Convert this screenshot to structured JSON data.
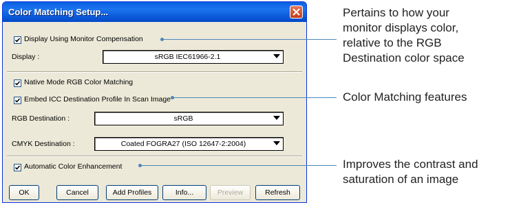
{
  "dialog": {
    "title": "Color Matching Setup...",
    "display_compensation": {
      "label": "Display Using Monitor Compensation",
      "checked": true
    },
    "display": {
      "label": "Display :",
      "value": "sRGB IEC61966-2.1"
    },
    "native_mode": {
      "label": "Native Mode RGB Color Matching",
      "checked": true
    },
    "embed_icc": {
      "label": "Embed ICC Destination Profile In Scan Image",
      "checked": true
    },
    "rgb_destination": {
      "label": "RGB Destination :",
      "value": "sRGB"
    },
    "cmyk_destination": {
      "label": "CMYK Destination :",
      "value": "Coated FOGRA27 (ISO 12647-2:2004)"
    },
    "auto_enhancement": {
      "label": "Automatic Color Enhancement",
      "checked": true
    },
    "buttons": {
      "ok": "OK",
      "cancel": "Cancel",
      "add_profiles": "Add Profiles",
      "info": "Info...",
      "preview": "Preview",
      "refresh": "Refresh"
    }
  },
  "annotations": {
    "monitor": [
      "Pertains to how your",
      "monitor displays color,",
      "relative to the RGB",
      "Destination color space"
    ],
    "features": [
      "Color Matching features"
    ],
    "enhancement": [
      "Improves the contrast and",
      "saturation of an image"
    ]
  },
  "colors": {
    "title_bar": "#0a5fe0",
    "close_button": "#c63b18",
    "dialog_face": "#ece9d8",
    "callout_line": "#4a86b8"
  }
}
